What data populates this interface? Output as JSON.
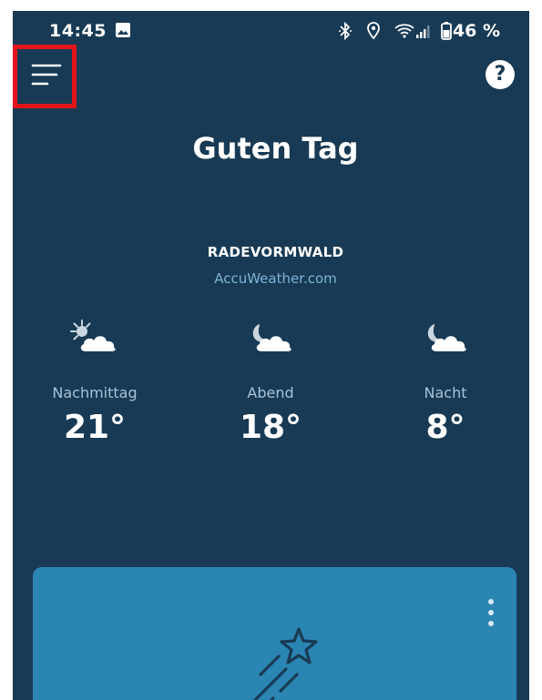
{
  "status_bar": {
    "time": "14:45",
    "battery_percent": "46 %",
    "icons": [
      "image-icon",
      "bluetooth-icon",
      "location-icon",
      "wifi-icon",
      "signal-icon",
      "battery-icon"
    ]
  },
  "header": {
    "menu_icon": "hamburger-menu-icon",
    "help_label": "?",
    "greeting": "Guten Tag"
  },
  "weather": {
    "location": "RADEVORMWALD",
    "source": "AccuWeather.com",
    "forecast": [
      {
        "period": "Nachmittag",
        "temp": "21°",
        "icon": "partly-sunny-icon"
      },
      {
        "period": "Abend",
        "temp": "18°",
        "icon": "partly-cloudy-night-icon"
      },
      {
        "period": "Nacht",
        "temp": "8°",
        "icon": "partly-cloudy-night-icon"
      }
    ]
  },
  "card": {
    "menu_icon": "more-vertical-icon",
    "illustration": "shooting-star-icon"
  },
  "colors": {
    "background": "#183a54",
    "card": "#2a85b3",
    "highlight": "#e3151b",
    "accent_text": "#7fb3d8"
  }
}
